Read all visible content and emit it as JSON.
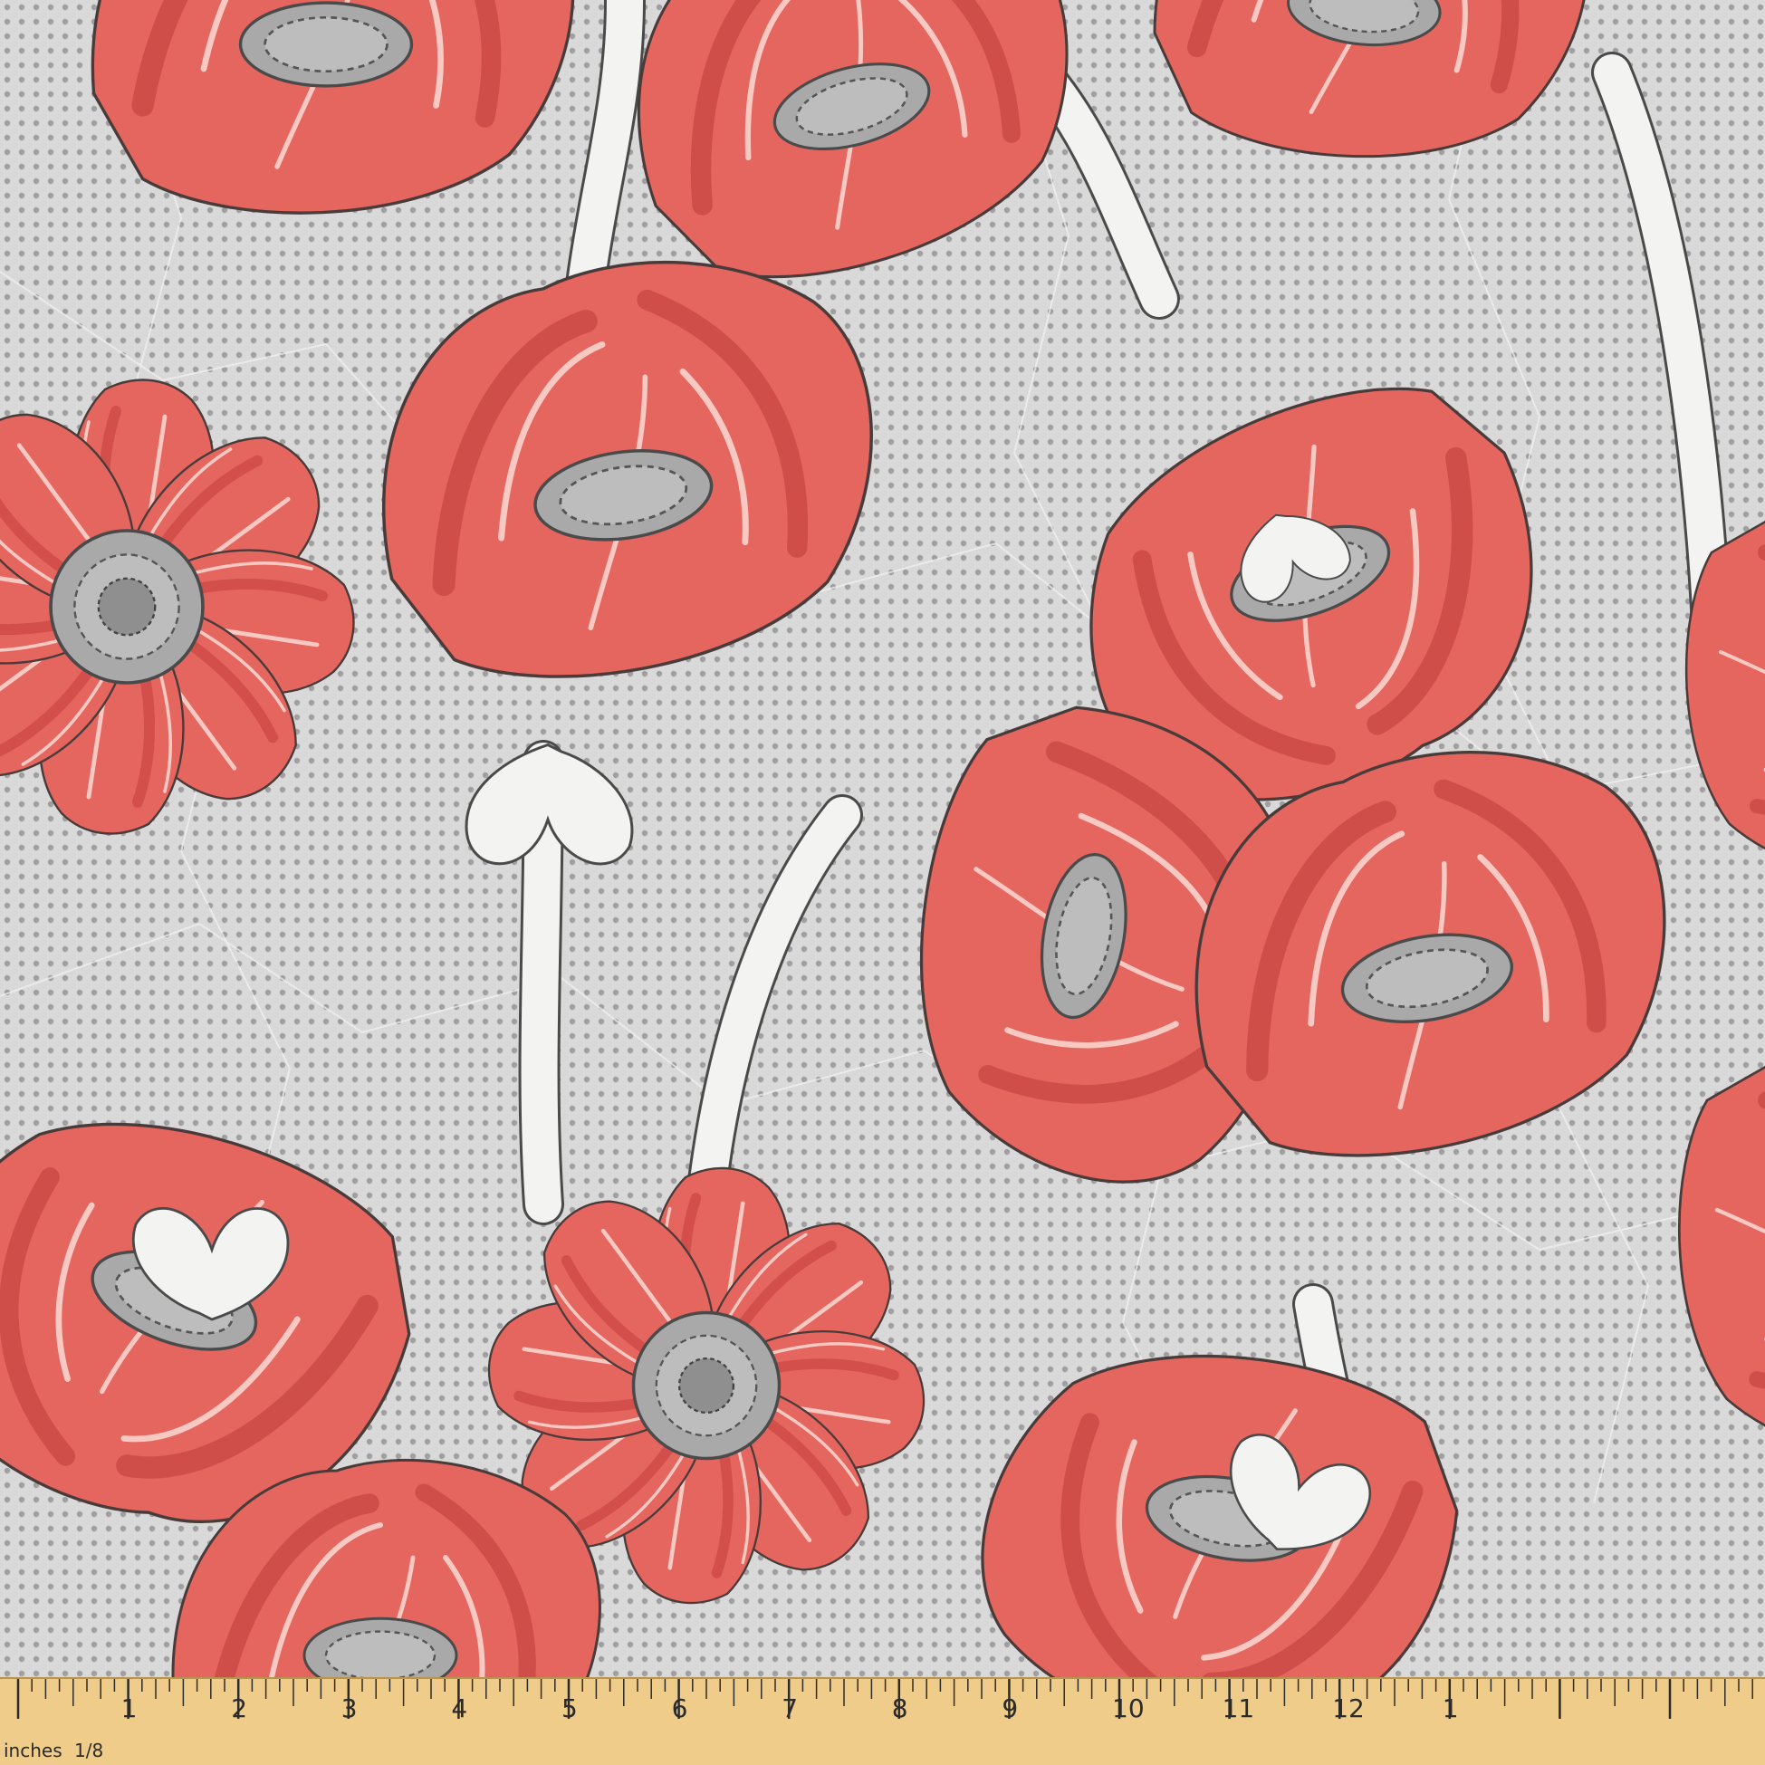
{
  "product": {
    "pattern": "poppy",
    "colors": {
      "background": "#d8d8d8",
      "dots": "#8a8a8a",
      "petal": "#e5665e",
      "petal_dark": "#cd4a47",
      "petal_highlight": "#f7c9c2",
      "outline": "#4a3b3b",
      "stem": "#f3f3f1",
      "center": "#a9a9a9",
      "ruler": "#f0cc8a"
    }
  },
  "ruler": {
    "unit_label": "inches",
    "fraction_label": "1/8",
    "numbers": [
      "1",
      "2",
      "3",
      "4",
      "5",
      "6",
      "7",
      "8",
      "9",
      "10",
      "11",
      "12",
      "1"
    ]
  }
}
